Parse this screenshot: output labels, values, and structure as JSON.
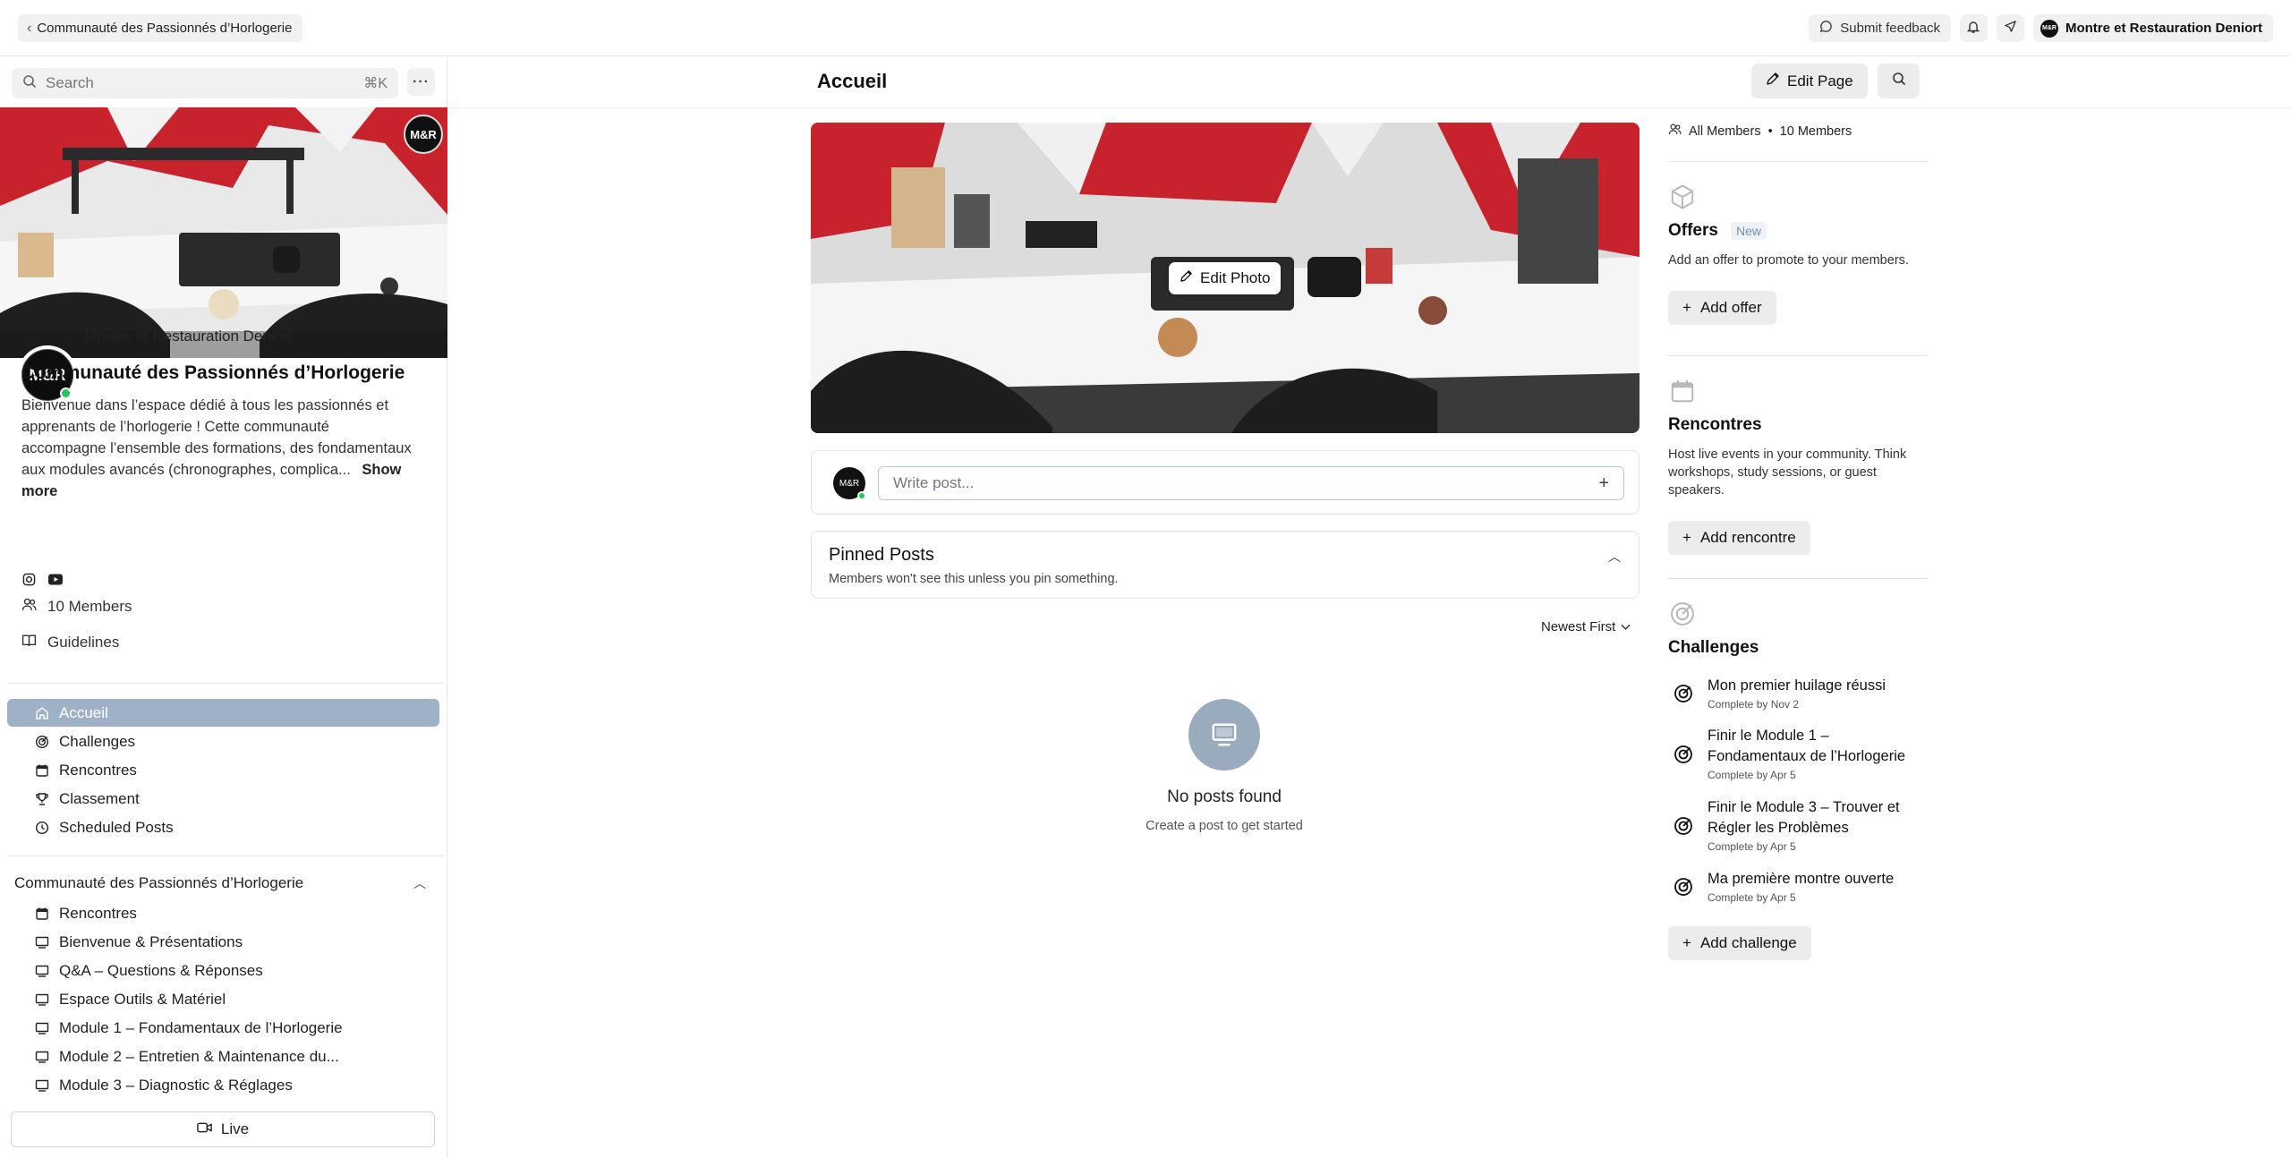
{
  "topbar": {
    "back_label": "Communauté des Passionnés d’Horlogerie",
    "feedback_label": "Submit feedback",
    "account_name": "Montre et Restauration Deniort",
    "account_initials": "M&R"
  },
  "sidebar": {
    "search_placeholder": "Search",
    "search_shortcut": "⌘K",
    "cover_logo": "M&R",
    "owner_initials": "M&R",
    "owner_name": "Montre et Restauration Deniort",
    "community_title": "Communauté des Passionnés d’Horlogerie",
    "community_description": "Bienvenue dans l’espace dédié à tous les passionnés et apprenants de l’horlogerie ! Cette communauté accompagne l’ensemble des formations, des fondamentaux aux modules avancés (chronographes, complica...",
    "show_more": "Show more",
    "members": "10 Members",
    "guidelines": "Guidelines",
    "nav": [
      {
        "label": "Accueil",
        "icon": "home-icon",
        "active": true
      },
      {
        "label": "Challenges",
        "icon": "target-icon",
        "active": false
      },
      {
        "label": "Rencontres",
        "icon": "calendar-icon",
        "active": false
      },
      {
        "label": "Classement",
        "icon": "trophy-icon",
        "active": false
      },
      {
        "label": "Scheduled Posts",
        "icon": "clock-icon",
        "active": false
      }
    ],
    "section_title": "Communauté des Passionnés d’Horlogerie",
    "section_items": [
      {
        "label": "Rencontres",
        "icon": "calendar-icon"
      },
      {
        "label": "Bienvenue & Présentations",
        "icon": "monitor-icon"
      },
      {
        "label": "Q&A – Questions & Réponses",
        "icon": "monitor-icon"
      },
      {
        "label": "Espace Outils & Matériel",
        "icon": "monitor-icon"
      },
      {
        "label": "Module 1 – Fondamentaux de l’Horlogerie",
        "icon": "monitor-icon"
      },
      {
        "label": "Module 2 – Entretien & Maintenance du...",
        "icon": "monitor-icon"
      },
      {
        "label": "Module 3 – Diagnostic & Réglages",
        "icon": "monitor-icon"
      }
    ],
    "live_label": "Live"
  },
  "main": {
    "title": "Accueil",
    "edit_page": "Edit Page",
    "edit_photo": "Edit Photo",
    "composer_avatar": "M&R",
    "composer_placeholder": "Write post...",
    "pinned_title": "Pinned Posts",
    "pinned_subtitle": "Members won't see this unless you pin something.",
    "sort_label": "Newest First",
    "empty_title": "No posts found",
    "empty_subtitle": "Create a post to get started"
  },
  "right": {
    "members_all": "All Members",
    "members_sep": "•",
    "members_count": "10 Members",
    "offers_title": "Offers",
    "offers_badge": "New",
    "offers_text": "Add an offer to promote to your members.",
    "offers_button": "Add offer",
    "rencontres_title": "Rencontres",
    "rencontres_text": "Host live events in your community. Think workshops, study sessions, or guest speakers.",
    "rencontres_button": "Add rencontre",
    "challenges_title": "Challenges",
    "challenges": [
      {
        "name": "Mon premier huilage réussi",
        "due": "Complete by Nov 2"
      },
      {
        "name": "Finir le Module 1 – Fondamentaux de l’Horlogerie",
        "due": "Complete by Apr 5"
      },
      {
        "name": "Finir le Module 3 – Trouver et Régler les Problèmes",
        "due": "Complete by Apr 5"
      },
      {
        "name": "Ma première montre ouverte",
        "due": "Complete by Apr 5"
      }
    ],
    "challenges_button": "Add challenge"
  },
  "colors": {
    "active_nav": "#9eb1c7",
    "online": "#22c55e",
    "workbench_red": "#c8232c"
  }
}
